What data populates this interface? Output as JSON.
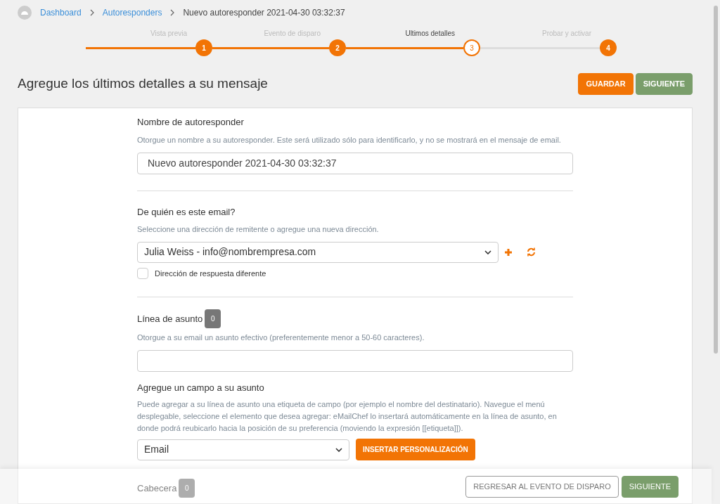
{
  "breadcrumb": [
    {
      "label": "Dashboard",
      "kind": "link"
    },
    {
      "label": "Autoresponders",
      "kind": "link"
    },
    {
      "label": "Nuevo autoresponder 2021-04-30 03:32:37",
      "kind": "current"
    }
  ],
  "steps": [
    {
      "label": "Vista previa",
      "number": "1",
      "selected": false
    },
    {
      "label": "Evento de disparo",
      "number": "2",
      "selected": false
    },
    {
      "label": "Ultimos detalles",
      "number": "3",
      "selected": true
    },
    {
      "label": "Probar y activar",
      "number": "4",
      "selected": false
    }
  ],
  "heading": "Agregue los últimos detalles a su mensaje",
  "header_buttons": [
    {
      "label": "GUARDAR",
      "kind": "primary"
    },
    {
      "label": "SIGUIENTE",
      "kind": "success"
    }
  ],
  "name_section": {
    "title": "Nombre de autoresponder",
    "help": "Otorgue un nombre a su autoresponder. Este será utilizado sólo para identificarlo, y no se mostrará en el mensaje de email.",
    "value": "Nuevo autoresponder 2021-04-30 03:32:37"
  },
  "sender_section": {
    "title": "De quién es este email?",
    "help": "Seleccione una dirección de remitente o agregue una nueva dirección.",
    "value": "Julia Weiss - info@nombrempresa.com",
    "checkbox": {
      "label": "Dirección de respuesta diferente",
      "checked": false
    }
  },
  "subject_section": {
    "title": "Línea de asunto",
    "count": "0",
    "help": "Otorgue a su email un asunto efectivo (preferentemente menor a 50-60 caracteres)."
  },
  "field_section": {
    "title": "Agregue un campo a su asunto",
    "help": "Puede agregar a su línea de asunto una etiqueta de campo (por ejemplo el nombre del destinatario). Navegue el menú desplegable, seleccione el elemento que desea agregar: eMailChef lo insertará automáticamente en la línea de asunto, en donde podrá reubicarlo hacia la posición de su preferencia (moviendo la expresión [[etiqueta]]).",
    "value": "Email",
    "button": "INSERTAR PERSONALIZACIÓN"
  },
  "header_section": {
    "title": "Cabecera",
    "count": "0"
  },
  "footer_buttons": [
    {
      "label": "REGRESAR AL EVENTO DE DISPARO",
      "kind": "outline"
    },
    {
      "label": "SIGUIENTE",
      "kind": "success"
    }
  ]
}
